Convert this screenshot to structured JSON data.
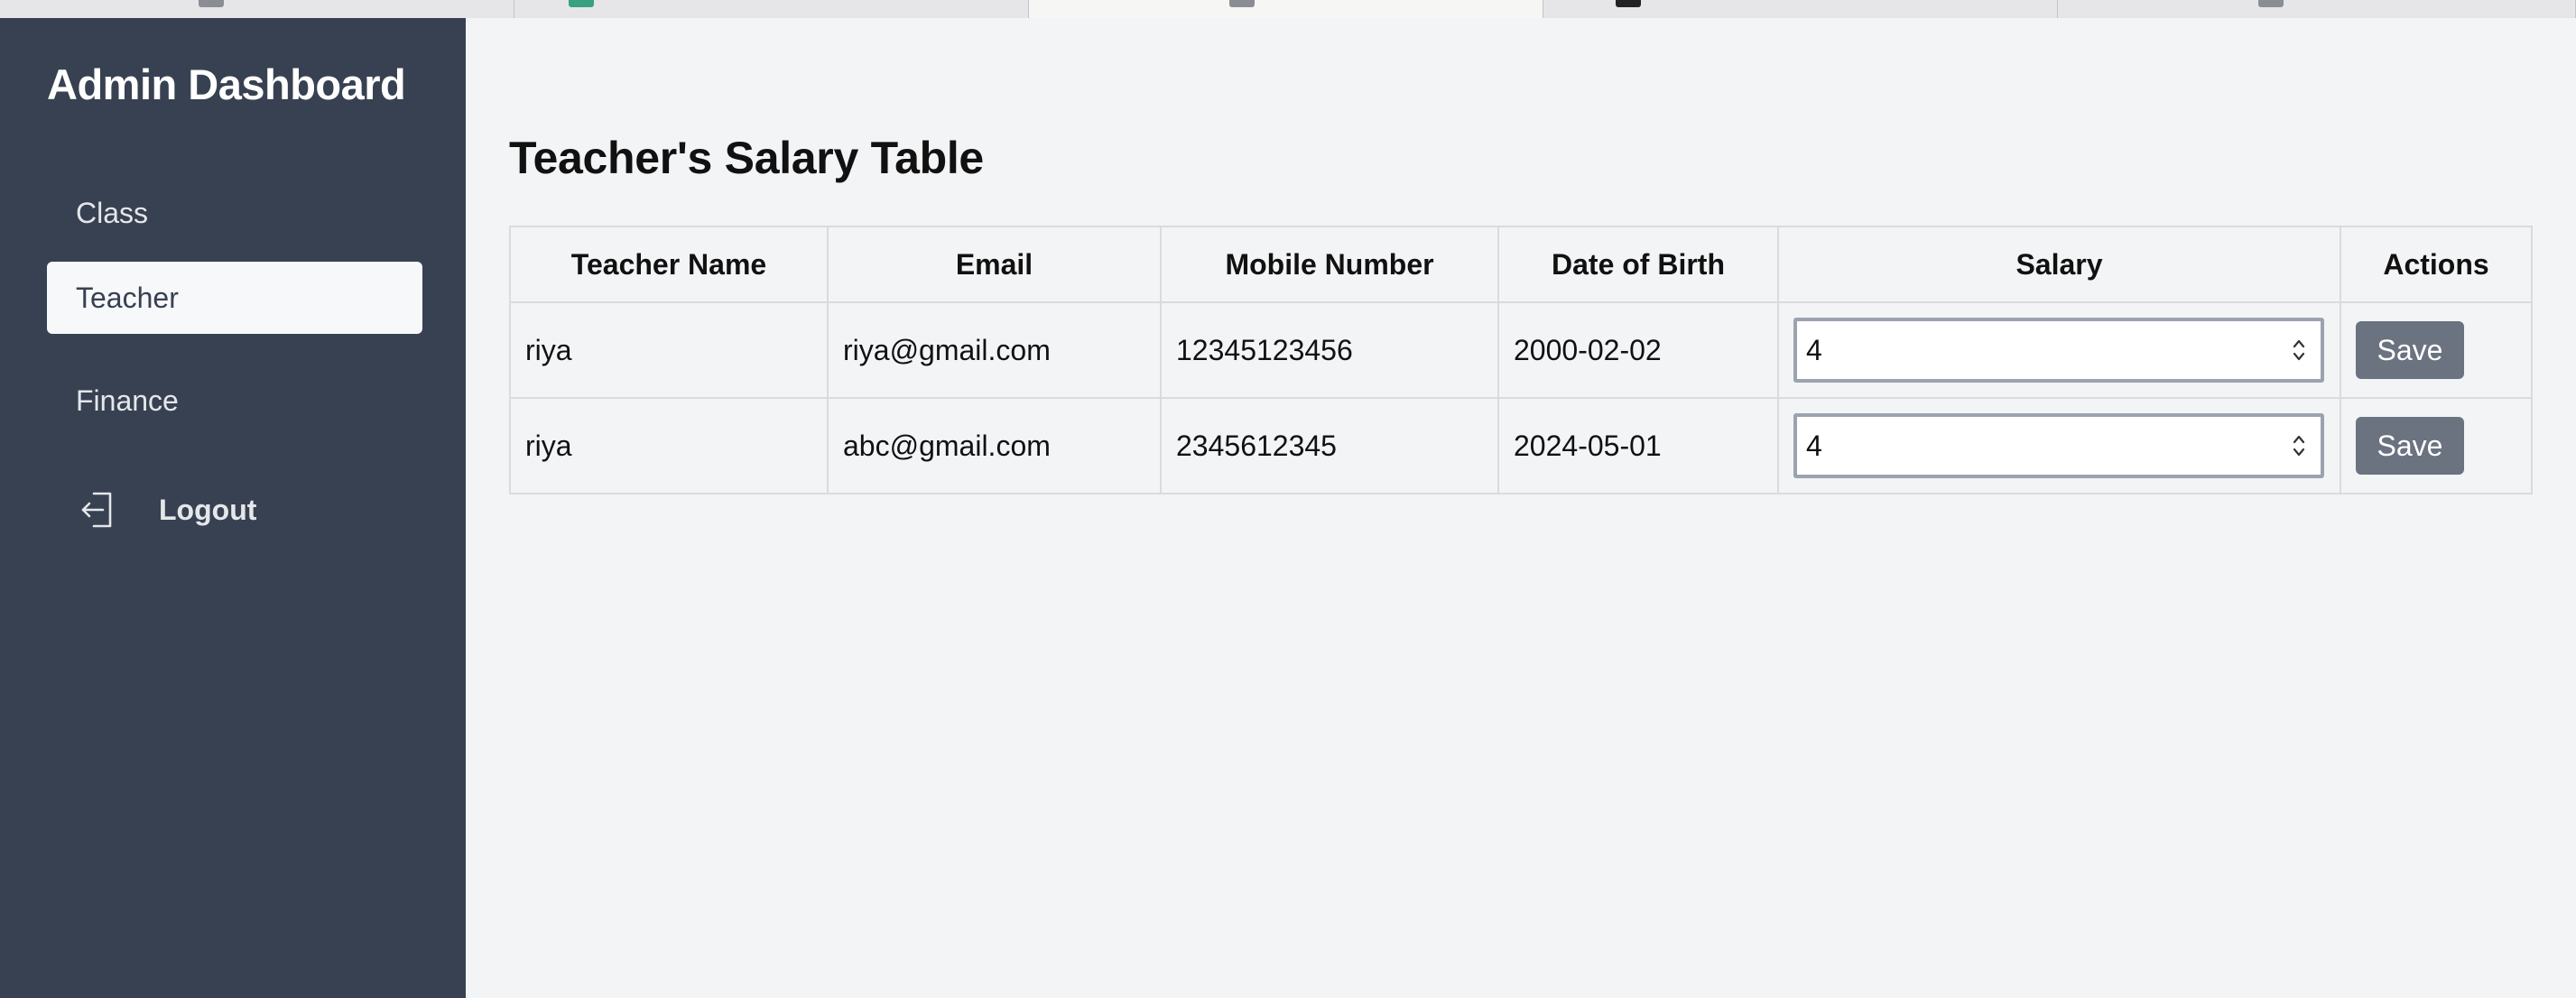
{
  "sidebar": {
    "title": "Admin Dashboard",
    "items": [
      {
        "label": "Class"
      },
      {
        "label": "Teacher"
      },
      {
        "label": "Finance"
      }
    ],
    "logout_label": "Logout",
    "logout_icon": "logout-icon"
  },
  "main": {
    "title": "Teacher's Salary Table",
    "table": {
      "headers": [
        "Teacher Name",
        "Email",
        "Mobile Number",
        "Date of Birth",
        "Salary",
        "Actions"
      ],
      "rows": [
        {
          "name": "riya",
          "email": "riya@gmail.com",
          "mobile": "12345123456",
          "dob": "2000-02-02",
          "salary": "4",
          "action": "Save"
        },
        {
          "name": "riya",
          "email": "abc@gmail.com",
          "mobile": "2345612345",
          "dob": "2024-05-01",
          "salary": "4",
          "action": "Save"
        }
      ]
    }
  },
  "colors": {
    "sidebar_bg": "#374151",
    "active_item_bg": "#f7f8fa",
    "button_bg": "#6b7280",
    "page_bg": "#f3f4f6"
  }
}
